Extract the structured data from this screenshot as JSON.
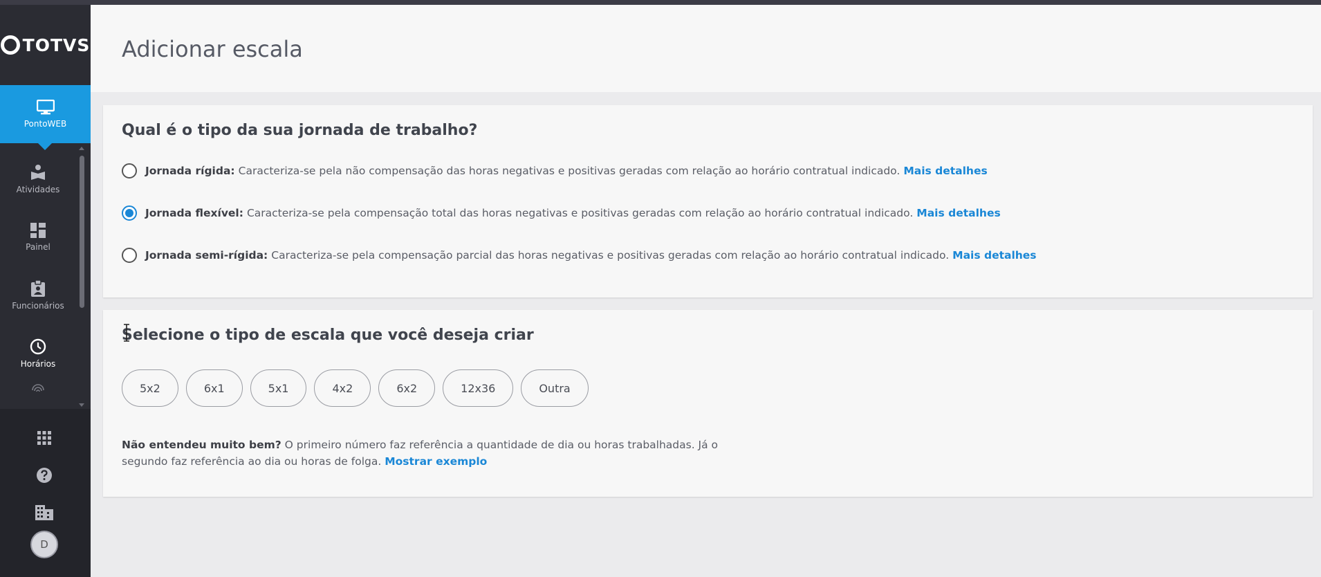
{
  "app": {
    "brand": "TOTVS",
    "active_module": "PontoWEB"
  },
  "sidebar": {
    "items": [
      {
        "label": "Atividades",
        "icon": "book-reader-icon"
      },
      {
        "label": "Painel",
        "icon": "dashboard-icon"
      },
      {
        "label": "Funcionários",
        "icon": "badge-icon"
      },
      {
        "label": "Horários",
        "icon": "clock-icon"
      }
    ],
    "partial_item_icon": "fingerprint-icon",
    "bottom": {
      "apps_icon": "apps-grid-icon",
      "help_icon": "help-icon",
      "company_icon": "building-icon",
      "avatar_initial": "D"
    }
  },
  "page": {
    "title": "Adicionar escala"
  },
  "journey": {
    "question": "Qual é o tipo da sua jornada de trabalho?",
    "options": [
      {
        "label": "Jornada rígida:",
        "description": "Caracteriza-se pela não compensação das horas negativas e positivas geradas com relação ao horário contratual indicado.",
        "link": "Mais detalhes",
        "selected": false
      },
      {
        "label": "Jornada flexível:",
        "description": "Caracteriza-se pela compensação total das horas negativas e positivas geradas com relação ao horário contratual indicado.",
        "link": "Mais detalhes",
        "selected": true
      },
      {
        "label": "Jornada semi-rígida:",
        "description": "Caracteriza-se pela compensação parcial das horas negativas e positivas geradas com relação ao horário contratual indicado.",
        "link": "Mais detalhes",
        "selected": false
      }
    ]
  },
  "scale": {
    "question": "Selecione o tipo de escala que você deseja criar",
    "types": [
      "5x2",
      "6x1",
      "5x1",
      "4x2",
      "6x2",
      "12x36",
      "Outra"
    ],
    "help_bold": "Não entendeu muito bem?",
    "help_text": "O primeiro número faz referência a quantidade de dia ou horas trabalhadas. Já o segundo faz referência ao dia ou horas de folga.",
    "help_link": "Mostrar exemplo"
  },
  "colors": {
    "accent": "#1a9ae0",
    "link": "#1a87d6",
    "sidebar": "#2b2c33"
  }
}
